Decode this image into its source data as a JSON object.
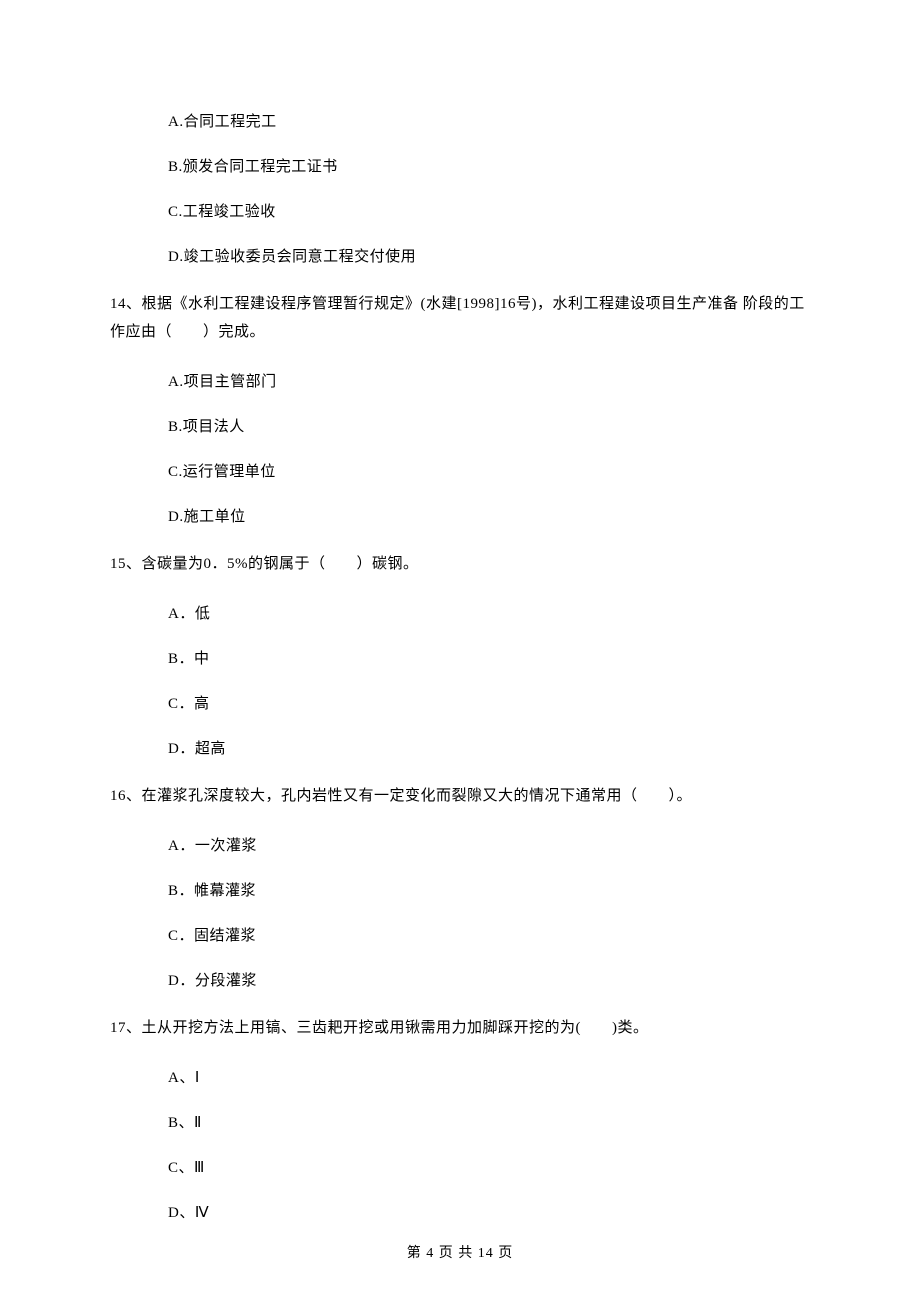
{
  "q13": {
    "options": {
      "A": "A.合同工程完工",
      "B": "B.颁发合同工程完工证书",
      "C": "C.工程竣工验收",
      "D": "D.竣工验收委员会同意工程交付使用"
    }
  },
  "q14": {
    "stem": "14、根据《水利工程建设程序管理暂行规定》(水建[1998]16号)，水利工程建设项目生产准备 阶段的工作应由（　　）完成。",
    "options": {
      "A": "A.项目主管部门",
      "B": "B.项目法人",
      "C": "C.运行管理单位",
      "D": "D.施工单位"
    }
  },
  "q15": {
    "stem": "15、含碳量为0．5%的钢属于（　　）碳钢。",
    "options": {
      "A": "A．低",
      "B": "B．中",
      "C": "C．高",
      "D": "D．超高"
    }
  },
  "q16": {
    "stem": "16、在灌浆孔深度较大，孔内岩性又有一定变化而裂隙又大的情况下通常用（　　）。",
    "options": {
      "A": "A．一次灌浆",
      "B": "B．帷幕灌浆",
      "C": "C．固结灌浆",
      "D": "D．分段灌浆"
    }
  },
  "q17": {
    "stem": "17、土从开挖方法上用镐、三齿耙开挖或用锹需用力加脚踩开挖的为(　　)类。",
    "options": {
      "A": "A、Ⅰ",
      "B": "B、Ⅱ",
      "C": "C、Ⅲ",
      "D": "D、Ⅳ"
    }
  },
  "footer": "第 4 页 共 14 页"
}
